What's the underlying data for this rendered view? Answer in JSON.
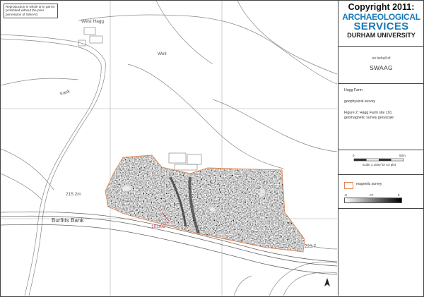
{
  "notice": {
    "text": "Reproduction in whole or in part is prohibited without the prior permission of SWAAG"
  },
  "map": {
    "labels": {
      "west_hagg": "West Hagg",
      "well": "Well",
      "track": "track",
      "spot_height_west": "215.2m",
      "burfitts_bank": "Burfitts Bank",
      "site_code": "101/03",
      "spot_height_east": "223.7"
    }
  },
  "title_block": {
    "copyright": "Copyright 2011:",
    "logo_line1": "ARCHAEOLOGICAL",
    "logo_line2": "SERVICES",
    "logo_line3": "DURHAM UNIVERSITY",
    "on_behalf": "on behalf of",
    "client": "SWAAG",
    "site": "Hagg Farm",
    "survey_type": "geophysical survey",
    "figure_line1": "Figure 2: Hagg Farm site 101",
    "figure_line2": "geomagnetic survey greyscale"
  },
  "scale_bar": {
    "start": "0",
    "end": "50m",
    "caption": "scale 1:1000 for A3 plot"
  },
  "legend": {
    "survey_label": "magnetic survey",
    "ticks": [
      "-5",
      "nT",
      "5"
    ]
  },
  "colors": {
    "logo_blue": "#1a7ab8",
    "survey_outline": "#e08550",
    "site_code_red": "#d23"
  }
}
